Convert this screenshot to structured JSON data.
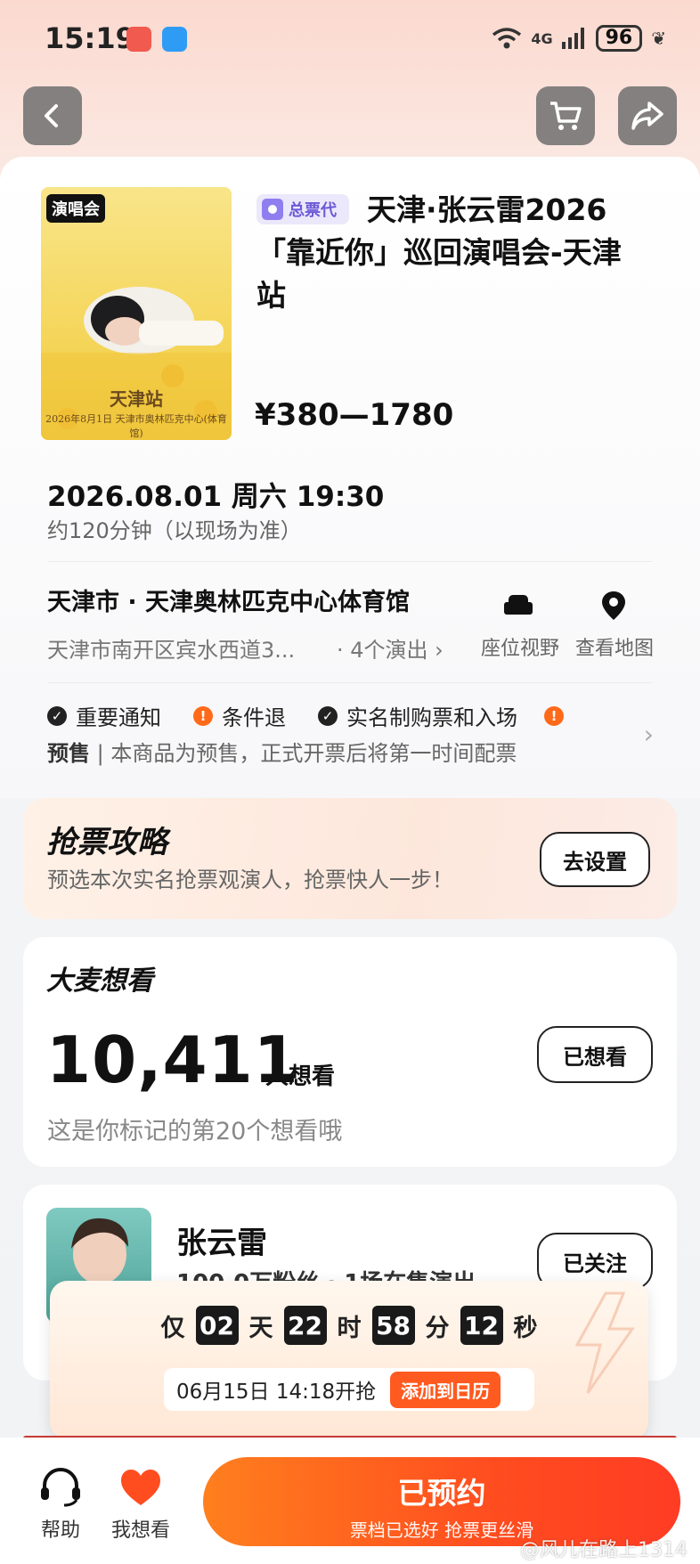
{
  "status_bar": {
    "time": "15:19",
    "network": "4G",
    "battery": "96"
  },
  "event": {
    "poster_tag": "演唱会",
    "poster_station": "天津站",
    "poster_date": "2026年8月1日 天津市奥林匹克中心(体育馆)",
    "agent_label": "总票代",
    "title": "天津·张云雷2026「靠近你」巡回演唱会-天津站",
    "price": "¥380—1780",
    "datetime": "2026.08.01 周六 19:30",
    "duration": "约120分钟（以现场为准）",
    "venue": "天津市 · 天津奥林匹克中心体育馆",
    "address": "天津市南开区宾水西道3...",
    "shows": "· 4个演出",
    "seat_view_label": "座位视野",
    "map_label": "查看地图"
  },
  "notices": {
    "items": [
      "重要通知",
      "条件退",
      "实名制购票和入场"
    ],
    "presale_tag": "预售",
    "presale_text": " | 本商品为预售，正式开票后将第一时间配票"
  },
  "strategy": {
    "title": "抢票攻略",
    "subtitle": "预选本次实名抢票观演人，抢票快人一步！",
    "button": "去设置"
  },
  "want": {
    "title": "大麦想看",
    "count": "10,411",
    "unit": "人想看",
    "note": "这是你标记的第20个想看哦",
    "button": "已想看"
  },
  "artist": {
    "name": "张云雷",
    "stats": "100.0万粉丝 · 1场在售演出",
    "button": "已关注"
  },
  "countdown": {
    "prefix": "仅",
    "days": "02",
    "day_unit": "天",
    "hours": "22",
    "hour_unit": "时",
    "minutes": "58",
    "minute_unit": "分",
    "seconds": "12",
    "second_unit": "秒",
    "sale_time": "06月15日 14:18开抢",
    "calendar_button": "添加到日历"
  },
  "bottom": {
    "help_label": "帮助",
    "wishlist_label": "我想看",
    "cta_main": "已预约",
    "cta_sub": "票档已选好 抢票更丝滑",
    "watermark": "@风儿在路上1314"
  },
  "colors": {
    "accent": "#ff4d1f",
    "warning": "#ff6a1a",
    "agent": "#6b5ad6"
  }
}
